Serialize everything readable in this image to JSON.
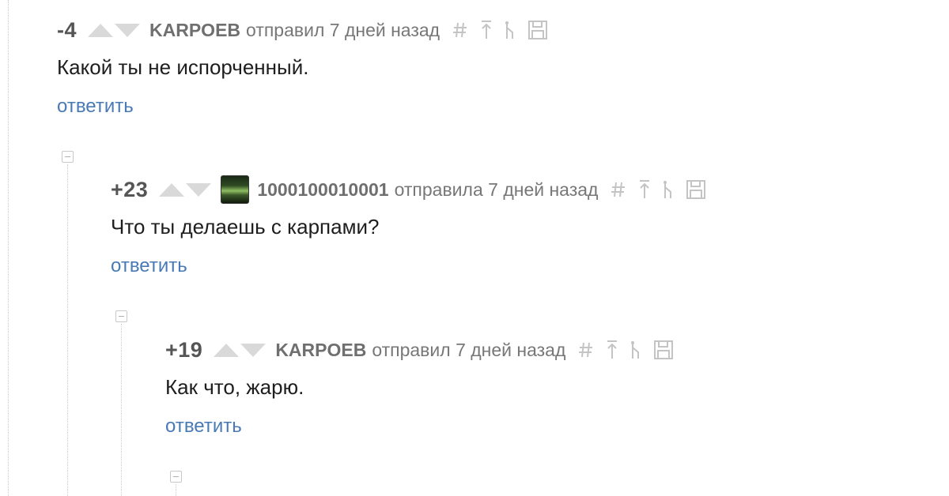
{
  "comments": [
    {
      "rating": "-4",
      "author": "KARPOEB",
      "meta": "отправил 7 дней назад",
      "text": "Какой ты не испорченный.",
      "reply_label": "ответить",
      "has_avatar": false
    },
    {
      "rating": "+23",
      "author": "1000100010001",
      "meta": "отправила 7 дней назад",
      "text": "Что ты делаешь с карпами?",
      "reply_label": "ответить",
      "has_avatar": true
    },
    {
      "rating": "+19",
      "author": "KARPOEB",
      "meta": "отправил 7 дней назад",
      "text": "Как что, жарю.",
      "reply_label": "ответить",
      "has_avatar": false
    }
  ],
  "tool_icons": [
    "hash-icon",
    "arrow-up-parent-icon",
    "branch-icon",
    "save-icon"
  ],
  "colors": {
    "link": "#4a7ab5",
    "rating": "#555555",
    "author": "#6f6f6f",
    "meta": "#777777",
    "icon": "#c4c4c4",
    "vote_arrow": "#d9d9d9"
  }
}
